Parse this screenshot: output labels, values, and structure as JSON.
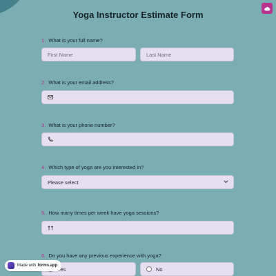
{
  "form": {
    "title": "Yoga Instructor Estimate Form",
    "questions": [
      {
        "number": "1.",
        "label": "What is your full name?",
        "first_placeholder": "First Name",
        "last_placeholder": "Last Name"
      },
      {
        "number": "2.",
        "label": "What is your email address?"
      },
      {
        "number": "3.",
        "label": "What is your phone number?"
      },
      {
        "number": "4.",
        "label": "Which type of yoga are you interested in?",
        "selected": "Please select"
      },
      {
        "number": "5.",
        "label": "How many times per week have yoga sessions?"
      },
      {
        "number": "6.",
        "label": "Do you have any previous experience with yoga?",
        "options": [
          "Yes",
          "No"
        ]
      }
    ]
  },
  "badge": {
    "prefix": "Made with",
    "brand": "forms.app"
  },
  "colors": {
    "background": "#7aaeb3",
    "field": "#e6dff0",
    "accent": "#b8338f"
  },
  "icons": [
    "cloud-icon",
    "mail-icon",
    "phone-icon",
    "number-icon",
    "chevron-down-icon",
    "forms-app-logo-icon"
  ]
}
